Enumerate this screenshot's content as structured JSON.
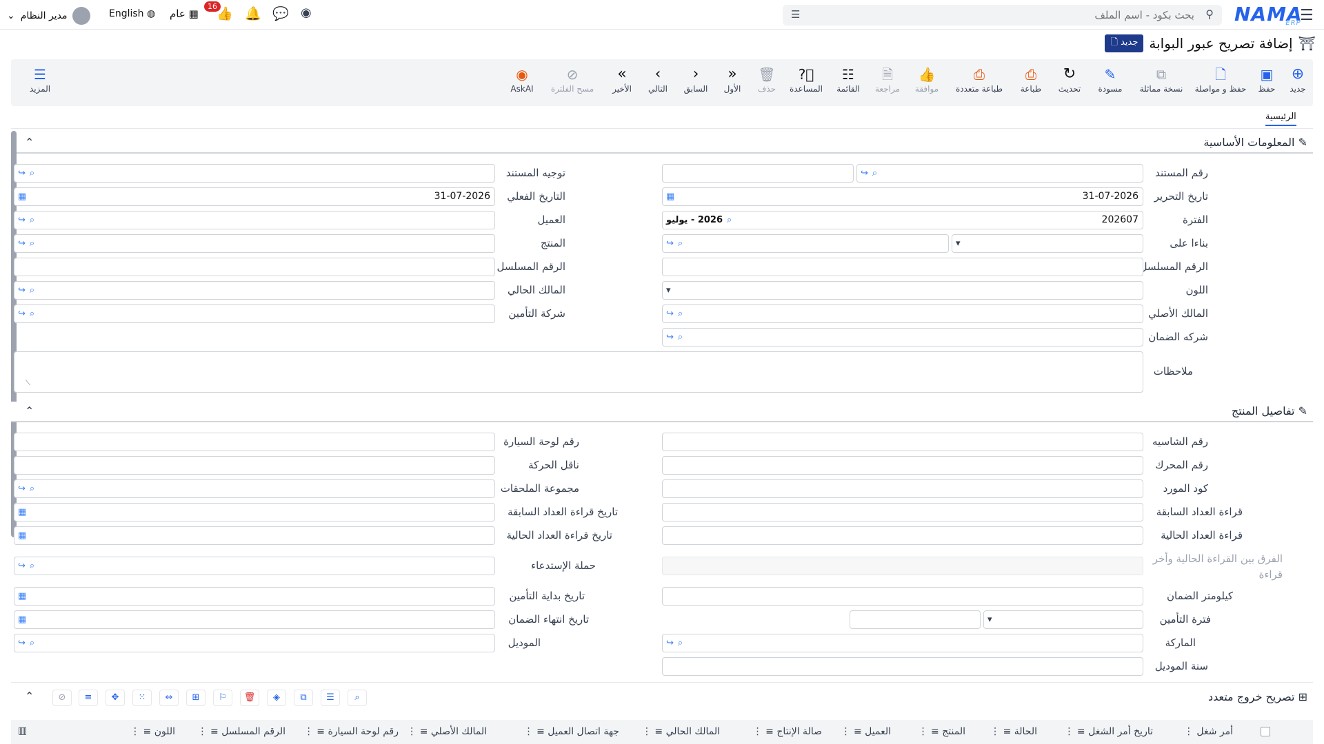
{
  "topbar": {
    "logo": "NAMA",
    "logo_sub": "ERP",
    "search_placeholder": "بحث بكود - اسم الملف",
    "user_name": "مدير النظام",
    "language": "English",
    "general": "عام",
    "badge_count": "16"
  },
  "page": {
    "title": "إضافة تصريح عبور البوابة",
    "new_badge": "جديد"
  },
  "toolbar": {
    "new": "جديد",
    "save": "حفظ",
    "save_continue": "حفظ و مواصلة",
    "copy": "نسخة مماثلة",
    "draft": "مسودة",
    "refresh": "تحديث",
    "print": "طباعة",
    "multi_print": "طباعة متعددة",
    "approve": "موافقة",
    "review": "مراجعة",
    "list": "القائمة",
    "help": "المساعدة",
    "delete": "حذف",
    "first": "الأول",
    "prev": "السابق",
    "next": "التالي",
    "last": "الأخير",
    "clear_filter": "مسح الفلترة",
    "askai": "AskAI",
    "more": "المزيد"
  },
  "tabs": {
    "main": "الرئيسية"
  },
  "sections": {
    "basic": "المعلومات الأساسية",
    "product": "تفاصيل المنتج",
    "multi_exit": "تصريح خروج متعدد"
  },
  "basic": {
    "doc_number": "رقم المستند",
    "doc_routing": "توجيه المستند",
    "edit_date": "تاريخ التحرير",
    "edit_date_val": "31-07-2026",
    "actual_date": "التاريخ الفعلي",
    "actual_date_val": "31-07-2026",
    "period": "الفترة",
    "period_val": "202607",
    "period_name": "2026 - يوليو",
    "customer": "العميل",
    "based_on": "بناءا على",
    "product": "المنتج",
    "serial": "الرقم المسلسل",
    "serial2": "الرقم المسلسل الثاني",
    "color": "اللون",
    "current_owner": "المالك الحالي",
    "original_owner": "المالك الأصلي",
    "insurance_company": "شركة التأمين",
    "warranty_company": "شركه الضمان",
    "notes": "ملاحظات"
  },
  "product": {
    "chassis": "رقم الشاسيه",
    "plate": "رقم لوحة السيارة",
    "engine": "رقم المحرك",
    "carrier": "ناقل الحركة",
    "supplier_code": "كود المورد",
    "accessories": "مجموعة الملحقات",
    "prev_reading": "قراءة العداد السابقة",
    "prev_reading_date": "تاريخ قراءة العداد السابقة",
    "curr_reading": "قراءة العداد الحالية",
    "curr_reading_date": "تاريخ قراءة العداد الحالية",
    "diff": "الفرق بين القراءة الحالية وأخر قراءة",
    "recall": "حملة الإستدعاء",
    "warranty_km": "كيلومتر الضمان",
    "insurance_start": "تاريخ بداية التأمين",
    "insurance_period": "فترة التأمين",
    "warranty_end": "تاريخ انتهاء الضمان",
    "brand": "الماركة",
    "model": "الموديل",
    "model_year": "سنة الموديل"
  },
  "grid_columns": [
    "أمر شغل",
    "تاريخ أمر الشغل",
    "الحالة",
    "المنتج",
    "العميل",
    "صالة الإنتاج",
    "المالك الحالي",
    "جهة اتصال العميل",
    "المالك الأصلي",
    "رقم لوحة السيارة",
    "الرقم المسلسل",
    "اللون"
  ],
  "colors": {
    "accent": "#2563eb",
    "danger": "#dc2626",
    "print": "#ea580c"
  }
}
